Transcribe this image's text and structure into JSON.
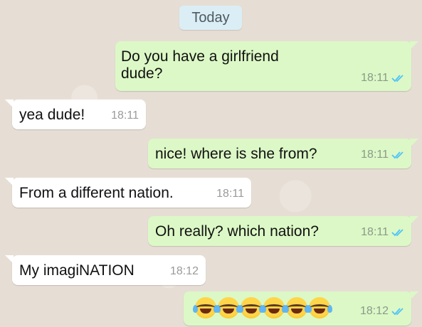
{
  "date_chip": "Today",
  "messages": [
    {
      "direction": "outgoing",
      "lines": [
        "Do you have a girlfriend",
        "dude?"
      ],
      "time": "18:11",
      "status": "read-double-check-icon"
    },
    {
      "direction": "incoming",
      "text": "yea dude!",
      "time": "18:11"
    },
    {
      "direction": "outgoing",
      "text": "nice! where is she from?",
      "time": "18:11",
      "status": "read-double-check-icon"
    },
    {
      "direction": "incoming",
      "text": "From a different nation.",
      "time": "18:11"
    },
    {
      "direction": "outgoing",
      "text": "Oh really? which nation?",
      "time": "18:11",
      "status": "read-double-check-icon"
    },
    {
      "direction": "incoming",
      "text": "My imagiNATION",
      "time": "18:12"
    },
    {
      "direction": "outgoing",
      "emoji": [
        "face-with-tears-of-joy-icon",
        "face-with-tears-of-joy-icon",
        "face-with-tears-of-joy-icon",
        "face-with-tears-of-joy-icon",
        "face-with-tears-of-joy-icon",
        "face-with-tears-of-joy-icon"
      ],
      "time": "18:12",
      "status": "read-double-check-icon"
    }
  ],
  "colors": {
    "outgoing_bubble": "#dcf8c6",
    "incoming_bubble": "#ffffff",
    "read_ticks": "#4fc3f7",
    "chat_background": "#e6ded4"
  }
}
